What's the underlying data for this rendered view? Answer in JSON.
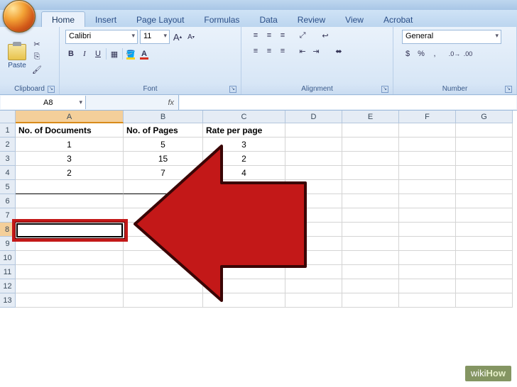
{
  "tabs": [
    "Home",
    "Insert",
    "Page Layout",
    "Formulas",
    "Data",
    "Review",
    "View",
    "Acrobat"
  ],
  "active_tab": "Home",
  "groups": {
    "clipboard": {
      "label": "Clipboard",
      "paste": "Paste"
    },
    "font": {
      "label": "Font",
      "name": "Calibri",
      "size": "11",
      "bold": "B",
      "italic": "I",
      "underline": "U"
    },
    "alignment": {
      "label": "Alignment"
    },
    "number": {
      "label": "Number",
      "format": "General",
      "currency": "$",
      "percent": "%",
      "comma": ","
    }
  },
  "namebox": "A8",
  "fx_label": "fx",
  "columns": [
    "A",
    "B",
    "C",
    "D",
    "E",
    "F",
    "G"
  ],
  "col_widths": [
    "cA",
    "cB",
    "cC",
    "cD",
    "cE",
    "cF",
    "cG"
  ],
  "row_count": 13,
  "selected_col": "A",
  "selected_row": 8,
  "sheet": {
    "headers": [
      "No. of Documents",
      "No. of Pages",
      "Rate per page"
    ],
    "rows": [
      {
        "a": "1",
        "b": "5",
        "c": "3"
      },
      {
        "a": "3",
        "b": "15",
        "c": "2"
      },
      {
        "a": "2",
        "b": "7",
        "c": "4"
      }
    ]
  },
  "watermark": {
    "prefix": "wiki",
    "suffix": "How"
  }
}
